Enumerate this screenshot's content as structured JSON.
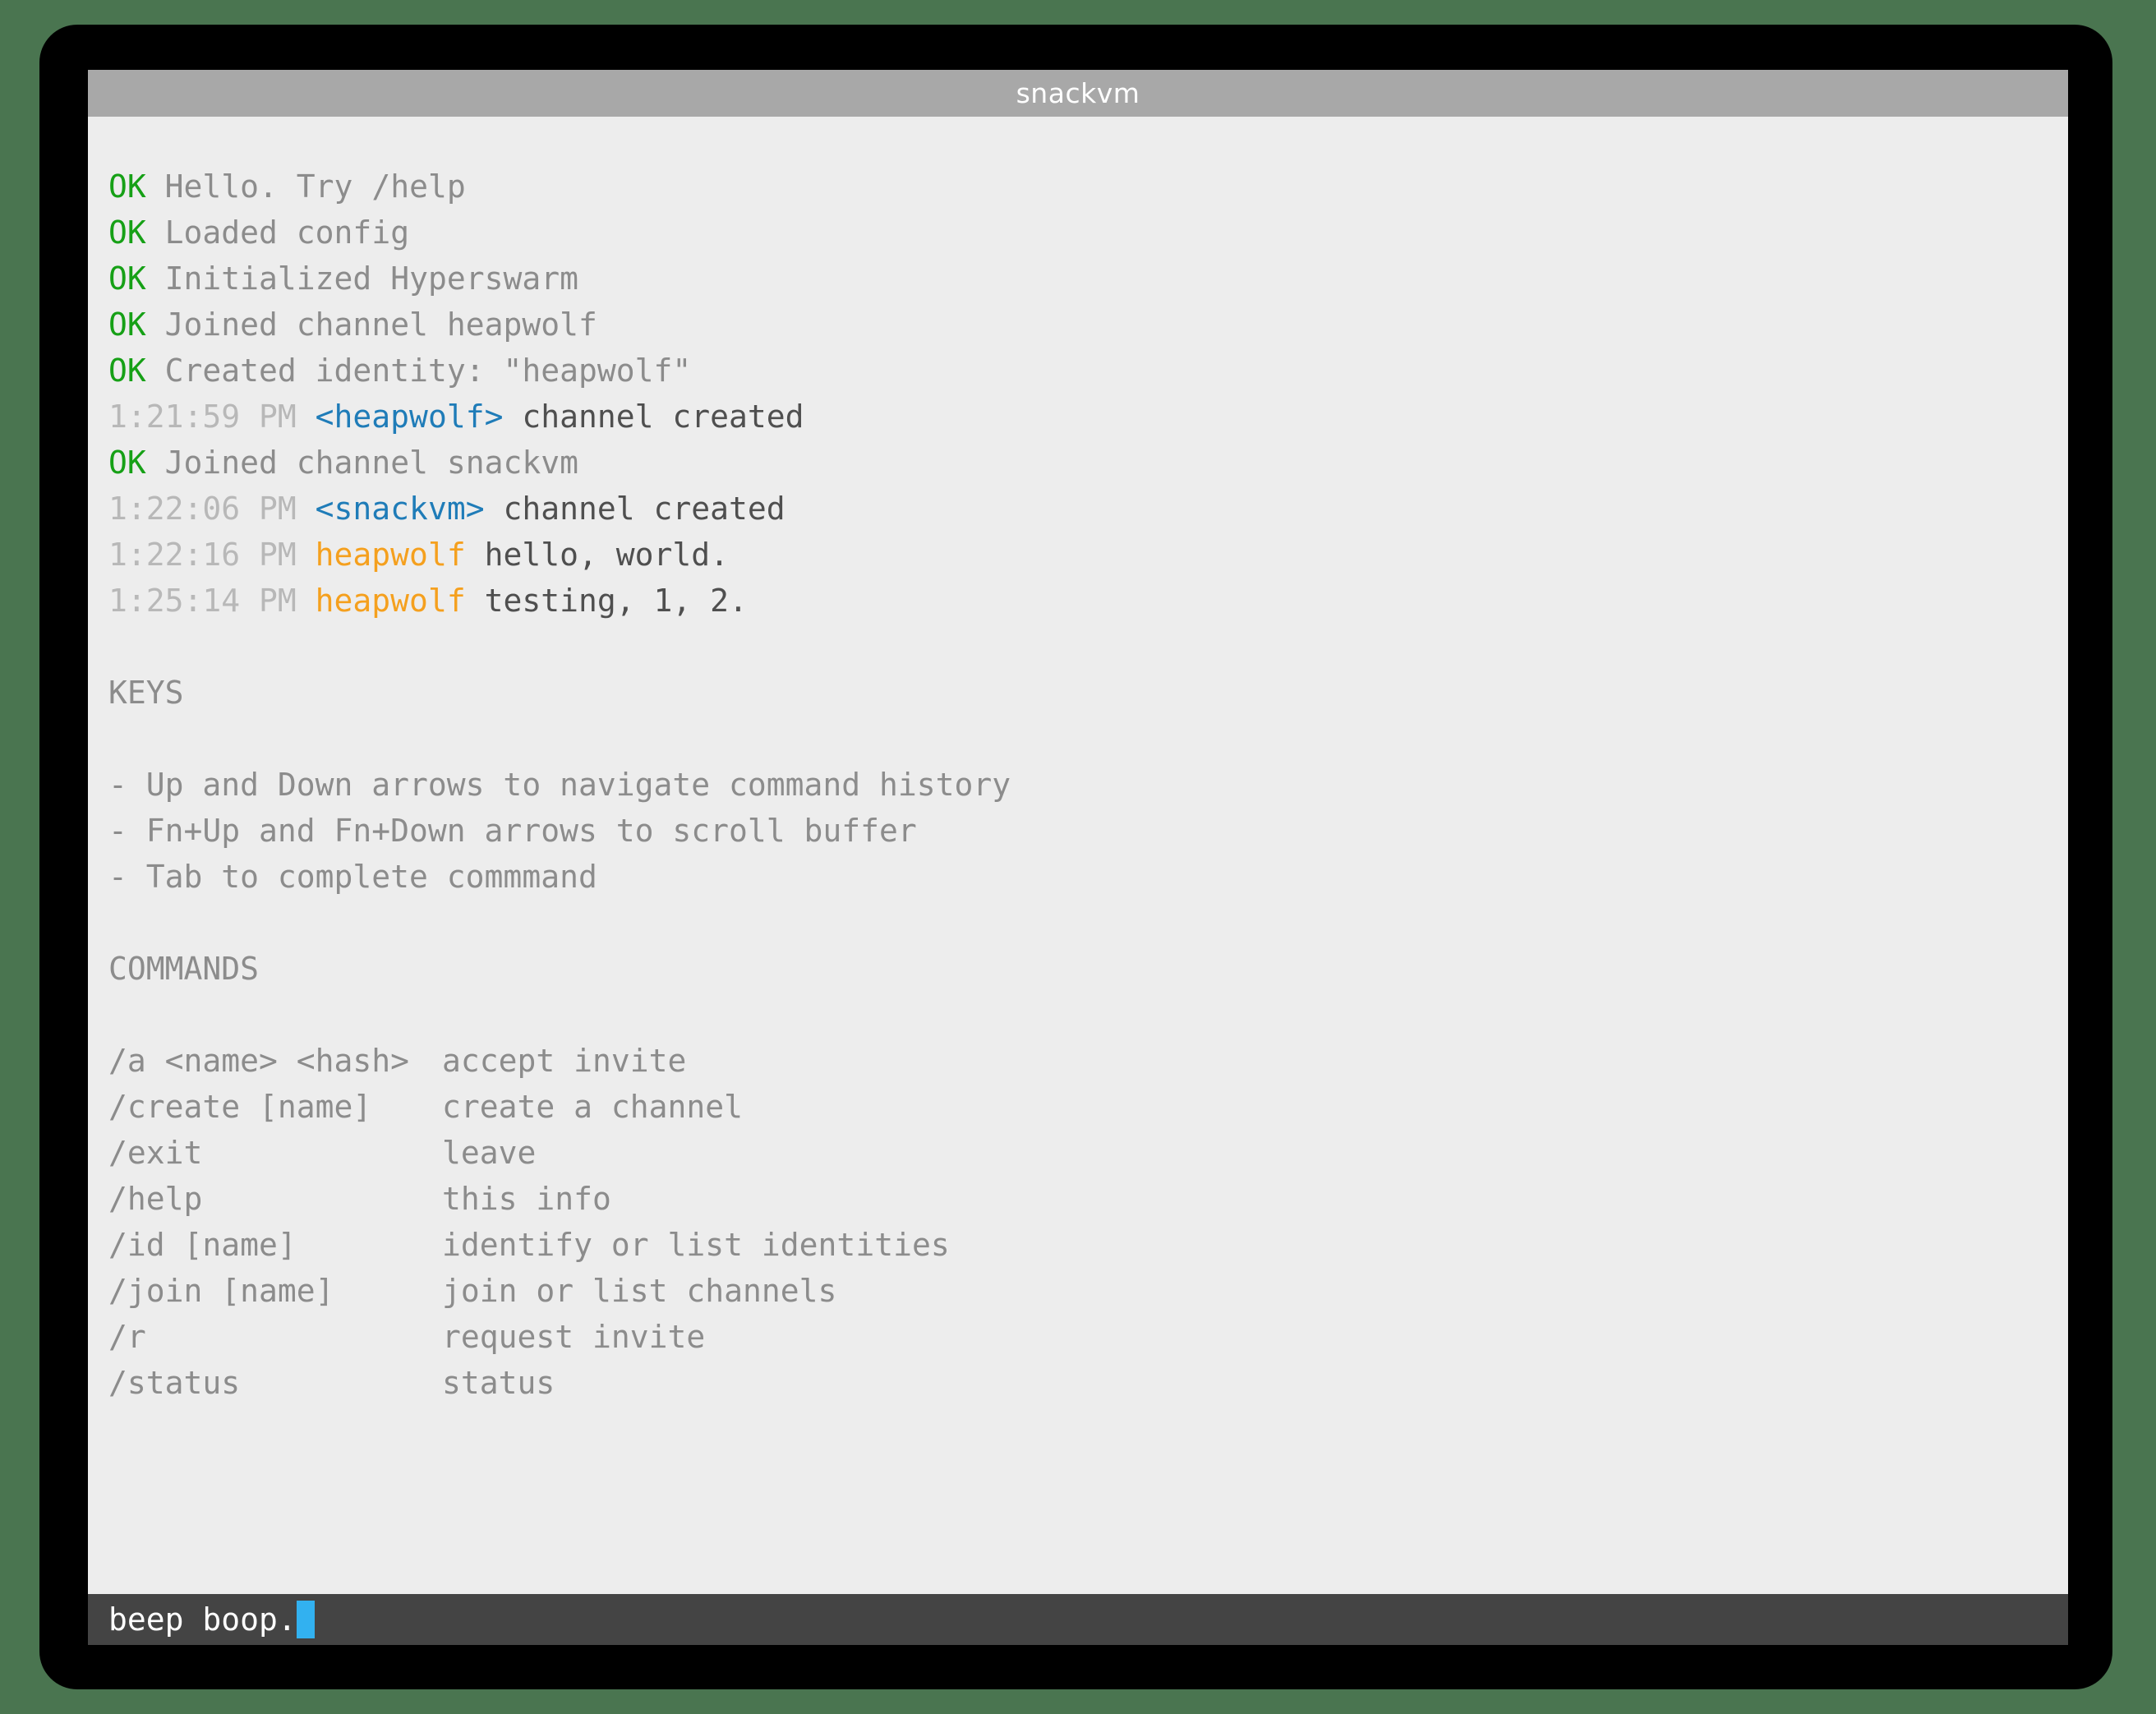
{
  "window": {
    "title": "snackvm",
    "bezel_color": "#000000",
    "desktop_color": "#4a7550",
    "titlebar_color": "#a8a8a8",
    "body_color": "#ededed"
  },
  "colors": {
    "ok_green": "#16a016",
    "timestamp_gray": "#b8b8b8",
    "channel_blue": "#1f7cb8",
    "user_orange": "#f5a01e",
    "message_gray": "#4f4f4f",
    "system_gray": "#8c8c8c",
    "cursor_blue": "#32b1f0",
    "input_bg": "#444444"
  },
  "buffer": {
    "status_lines": [
      {
        "status": "OK",
        "text": "Hello. Try /help"
      },
      {
        "status": "OK",
        "text": "Loaded config"
      },
      {
        "status": "OK",
        "text": "Initialized Hyperswarm"
      },
      {
        "status": "OK",
        "text": "Joined channel heapwolf"
      },
      {
        "status": "OK",
        "text": "Created identity: \"heapwolf\""
      }
    ],
    "line_heapwolf_created": {
      "time": "1:21:59 PM",
      "channel": "<heapwolf>",
      "message": "channel created"
    },
    "line_joined_snackvm": {
      "status": "OK",
      "text": "Joined channel snackvm"
    },
    "line_snackvm_created": {
      "time": "1:22:06 PM",
      "channel": "<snackvm>",
      "message": "channel created"
    },
    "chat": [
      {
        "time": "1:22:16 PM",
        "user": "heapwolf",
        "message": "hello, world."
      },
      {
        "time": "1:25:14 PM",
        "user": "heapwolf",
        "message": "testing, 1, 2."
      }
    ]
  },
  "help": {
    "keys_heading": "KEYS",
    "keys": [
      "- Up and Down arrows to navigate command history",
      "- Fn+Up and Fn+Down arrows to scroll buffer",
      "- Tab to complete commmand"
    ],
    "commands_heading": "COMMANDS",
    "commands": [
      {
        "name": "/a <name> <hash>",
        "desc": "accept invite"
      },
      {
        "name": "/create [name]",
        "desc": "create a channel"
      },
      {
        "name": "/exit",
        "desc": "leave"
      },
      {
        "name": "/help",
        "desc": "this info"
      },
      {
        "name": "/id [name]",
        "desc": "identify or list identities"
      },
      {
        "name": "/join [name]",
        "desc": "join or list channels"
      },
      {
        "name": "/r",
        "desc": "request invite"
      },
      {
        "name": "/status",
        "desc": "status"
      }
    ]
  },
  "input": {
    "value": "beep boop.",
    "cursor": "block"
  }
}
